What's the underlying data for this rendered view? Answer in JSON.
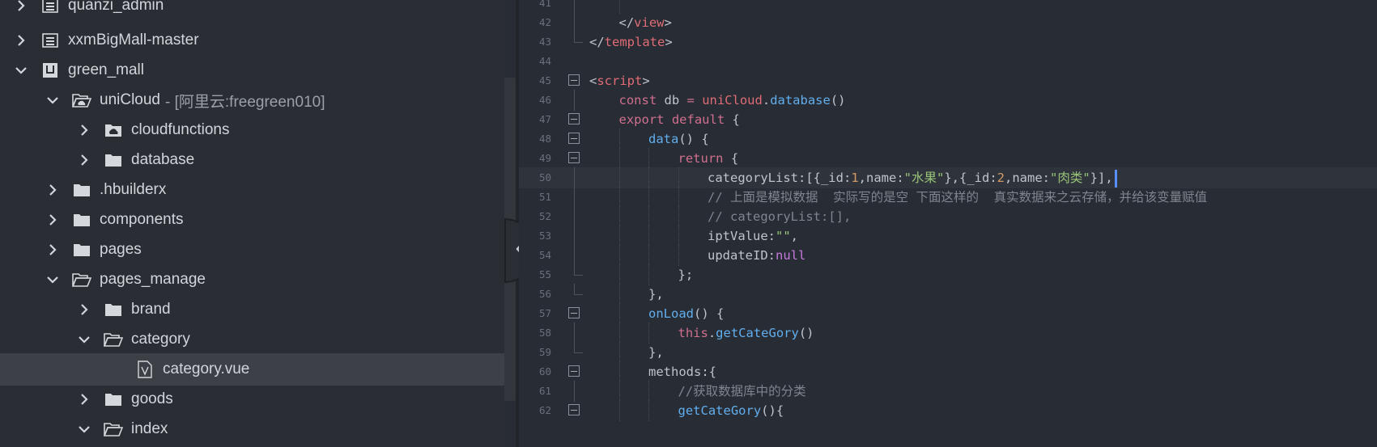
{
  "explorer": {
    "items": [
      {
        "label": "quanzi_admin",
        "suffix": "",
        "depth": 0,
        "expanded": false,
        "icon": "project-icon",
        "chevron": "right"
      },
      {
        "label": "xxmBigMall-master",
        "suffix": "",
        "depth": 0,
        "expanded": false,
        "icon": "project-icon",
        "chevron": "right"
      },
      {
        "label": "green_mall",
        "suffix": "",
        "depth": 0,
        "expanded": true,
        "icon": "uniapp-project-icon",
        "chevron": "down"
      },
      {
        "label": "uniCloud",
        "suffix": "- [阿里云:freegreen010]",
        "depth": 1,
        "expanded": true,
        "icon": "cloud-folder-open-icon",
        "chevron": "down"
      },
      {
        "label": "cloudfunctions",
        "suffix": "",
        "depth": 2,
        "expanded": false,
        "icon": "cloud-folder-icon",
        "chevron": "right"
      },
      {
        "label": "database",
        "suffix": "",
        "depth": 2,
        "expanded": false,
        "icon": "folder-icon",
        "chevron": "right"
      },
      {
        "label": ".hbuilderx",
        "suffix": "",
        "depth": 1,
        "expanded": false,
        "icon": "folder-icon",
        "chevron": "right"
      },
      {
        "label": "components",
        "suffix": "",
        "depth": 1,
        "expanded": false,
        "icon": "folder-icon",
        "chevron": "right"
      },
      {
        "label": "pages",
        "suffix": "",
        "depth": 1,
        "expanded": false,
        "icon": "folder-icon",
        "chevron": "right"
      },
      {
        "label": "pages_manage",
        "suffix": "",
        "depth": 1,
        "expanded": true,
        "icon": "folder-open-icon",
        "chevron": "down"
      },
      {
        "label": "brand",
        "suffix": "",
        "depth": 2,
        "expanded": false,
        "icon": "folder-icon",
        "chevron": "right"
      },
      {
        "label": "category",
        "suffix": "",
        "depth": 2,
        "expanded": true,
        "icon": "folder-open-icon",
        "chevron": "down"
      },
      {
        "label": "category.vue",
        "suffix": "",
        "depth": 3,
        "expanded": false,
        "icon": "vue-file-icon",
        "chevron": "none",
        "selected": true
      },
      {
        "label": "goods",
        "suffix": "",
        "depth": 2,
        "expanded": false,
        "icon": "folder-icon",
        "chevron": "right"
      },
      {
        "label": "index",
        "suffix": "",
        "depth": 2,
        "expanded": true,
        "icon": "folder-open-icon",
        "chevron": "down"
      }
    ]
  },
  "editor": {
    "current_line": 50,
    "lines": [
      {
        "n": 41,
        "fold": "line",
        "indent": 2,
        "tokens": []
      },
      {
        "n": 42,
        "fold": "line",
        "indent": 1,
        "tokens": [
          [
            "t-punct",
            "</"
          ],
          [
            "t-tag",
            "view"
          ],
          [
            "t-punct",
            ">"
          ]
        ]
      },
      {
        "n": 43,
        "fold": "end",
        "indent": 0,
        "tokens": [
          [
            "t-punct",
            "</"
          ],
          [
            "t-tag",
            "template"
          ],
          [
            "t-punct",
            ">"
          ]
        ]
      },
      {
        "n": 44,
        "fold": "",
        "indent": 0,
        "tokens": []
      },
      {
        "n": 45,
        "fold": "box",
        "indent": 0,
        "tokens": [
          [
            "t-punct",
            "<"
          ],
          [
            "t-tag",
            "script"
          ],
          [
            "t-punct",
            ">"
          ]
        ]
      },
      {
        "n": 46,
        "fold": "line",
        "indent": 1,
        "tokens": [
          [
            "t-keyword",
            "const"
          ],
          [
            "t-text",
            " db "
          ],
          [
            "t-keyword",
            "="
          ],
          [
            "t-text",
            " "
          ],
          [
            "t-tag",
            "uniCloud"
          ],
          [
            "t-punct",
            "."
          ],
          [
            "t-func",
            "database"
          ],
          [
            "t-punct",
            "()"
          ]
        ]
      },
      {
        "n": 47,
        "fold": "box",
        "indent": 1,
        "tokens": [
          [
            "t-keyword",
            "export"
          ],
          [
            "t-text",
            " "
          ],
          [
            "t-keyword",
            "default"
          ],
          [
            "t-text",
            " {"
          ]
        ]
      },
      {
        "n": 48,
        "fold": "box",
        "indent": 2,
        "tokens": [
          [
            "t-func",
            "data"
          ],
          [
            "t-punct",
            "() {"
          ]
        ]
      },
      {
        "n": 49,
        "fold": "box",
        "indent": 3,
        "tokens": [
          [
            "t-keyword",
            "return"
          ],
          [
            "t-text",
            " {"
          ]
        ]
      },
      {
        "n": 50,
        "fold": "line",
        "indent": 4,
        "tokens": [
          [
            "t-text",
            "categoryList:[{_id:"
          ],
          [
            "t-number",
            "1"
          ],
          [
            "t-text",
            ",name:"
          ],
          [
            "t-string",
            "\"水果\""
          ],
          [
            "t-text",
            "},{_id:"
          ],
          [
            "t-number",
            "2"
          ],
          [
            "t-text",
            ",name:"
          ],
          [
            "t-string",
            "\"肉类\""
          ],
          [
            "t-text",
            "}],"
          ]
        ]
      },
      {
        "n": 51,
        "fold": "line",
        "indent": 4,
        "tokens": [
          [
            "t-comment",
            "// 上面是模拟数据  实际写的是空 下面这样的  真实数据来之云存储，并给该变量赋值"
          ]
        ]
      },
      {
        "n": 52,
        "fold": "line",
        "indent": 4,
        "tokens": [
          [
            "t-comment",
            "// categoryList:[],"
          ]
        ]
      },
      {
        "n": 53,
        "fold": "line",
        "indent": 4,
        "tokens": [
          [
            "t-text",
            "iptValue:"
          ],
          [
            "t-string",
            "\"\""
          ],
          [
            "t-text",
            ","
          ]
        ]
      },
      {
        "n": 54,
        "fold": "line",
        "indent": 4,
        "tokens": [
          [
            "t-text",
            "updateID:"
          ],
          [
            "t-null",
            "null"
          ]
        ]
      },
      {
        "n": 55,
        "fold": "end",
        "indent": 3,
        "tokens": [
          [
            "t-text",
            "};"
          ]
        ]
      },
      {
        "n": 56,
        "fold": "end",
        "indent": 2,
        "tokens": [
          [
            "t-text",
            "},"
          ]
        ]
      },
      {
        "n": 57,
        "fold": "box",
        "indent": 2,
        "tokens": [
          [
            "t-func",
            "onLoad"
          ],
          [
            "t-punct",
            "() {"
          ]
        ]
      },
      {
        "n": 58,
        "fold": "line",
        "indent": 3,
        "tokens": [
          [
            "t-keyword",
            "this"
          ],
          [
            "t-punct",
            "."
          ],
          [
            "t-func",
            "getCateGory"
          ],
          [
            "t-punct",
            "()"
          ]
        ]
      },
      {
        "n": 59,
        "fold": "end",
        "indent": 2,
        "tokens": [
          [
            "t-text",
            "},"
          ]
        ]
      },
      {
        "n": 60,
        "fold": "box",
        "indent": 2,
        "tokens": [
          [
            "t-text",
            "methods:{"
          ]
        ]
      },
      {
        "n": 61,
        "fold": "line",
        "indent": 3,
        "tokens": [
          [
            "t-comment",
            "//获取数据库中的分类"
          ]
        ]
      },
      {
        "n": 62,
        "fold": "box",
        "indent": 3,
        "tokens": [
          [
            "t-func",
            "getCateGory"
          ],
          [
            "t-punct",
            "(){"
          ]
        ]
      }
    ]
  },
  "colors": {
    "sidebar_bg": "#2a2d33",
    "editor_bg": "#282c34",
    "selected_row": "#3d4047",
    "caret": "#5a8fff"
  }
}
